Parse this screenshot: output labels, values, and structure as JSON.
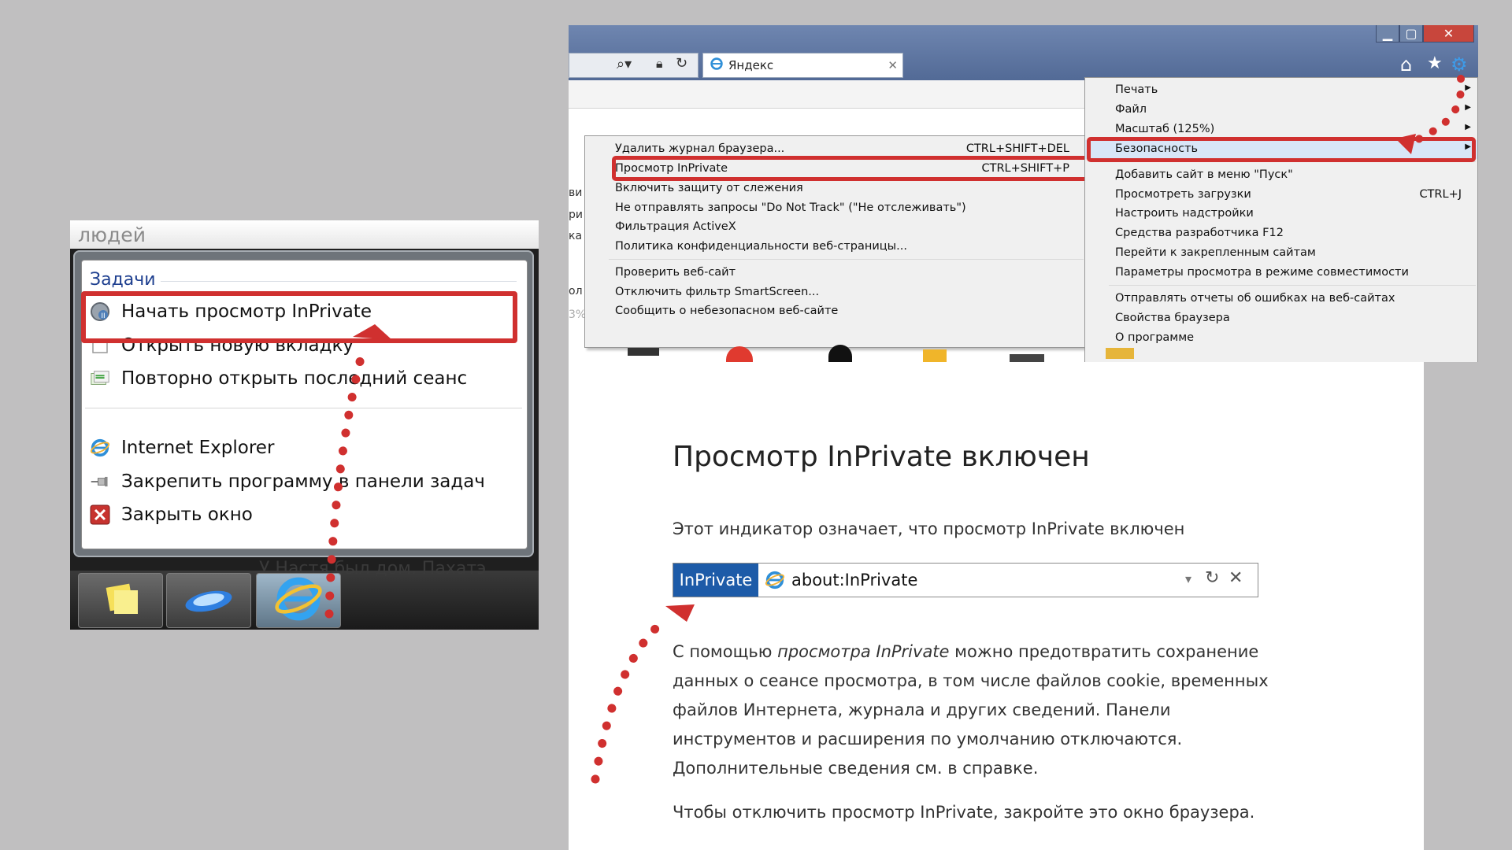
{
  "jumplist": {
    "top_text": "людей",
    "heading": "Задачи",
    "items": [
      {
        "label": "Начать просмотр InPrivate",
        "icon": "inprivate-icon"
      },
      {
        "label": "Открыть новую вкладку",
        "icon": "new-tab-icon"
      },
      {
        "label": "Повторно открыть последний сеанс",
        "icon": "reopen-session-icon"
      },
      {
        "label": "Internet Explorer",
        "icon": "ie-icon"
      },
      {
        "label": "Закрепить программу в панели задач",
        "icon": "pin-icon"
      },
      {
        "label": "Закрыть окно",
        "icon": "close-window-icon"
      }
    ],
    "background_text": "У Настя был дом. Пахатэ"
  },
  "browser": {
    "tab_title": "Яндекс",
    "tools_menu": {
      "items": [
        {
          "label": "Печать",
          "shortcut": "",
          "submenu": true
        },
        {
          "label": "Файл",
          "shortcut": "",
          "submenu": true
        },
        {
          "label": "Масштаб (125%)",
          "shortcut": "",
          "submenu": true
        },
        {
          "label": "Безопасность",
          "shortcut": "",
          "submenu": true
        },
        {
          "label": "Добавить сайт в меню \"Пуск\"",
          "shortcut": ""
        },
        {
          "label": "Просмотреть загрузки",
          "shortcut": "CTRL+J"
        },
        {
          "label": "Настроить надстройки",
          "shortcut": ""
        },
        {
          "label": "Средства разработчика F12",
          "shortcut": ""
        },
        {
          "label": "Перейти к закрепленным сайтам",
          "shortcut": ""
        },
        {
          "label": "Параметры просмотра в режиме совместимости",
          "shortcut": ""
        },
        {
          "label": "Отправлять отчеты об ошибках на веб-сайтах",
          "shortcut": ""
        },
        {
          "label": "Свойства браузера",
          "shortcut": ""
        },
        {
          "label": "О программе",
          "shortcut": ""
        }
      ]
    },
    "safety_menu": {
      "items": [
        {
          "label": "Удалить журнал браузера...",
          "shortcut": "CTRL+SHIFT+DEL"
        },
        {
          "label": "Просмотр InPrivate",
          "shortcut": "CTRL+SHIFT+P"
        },
        {
          "label": "Включить защиту от слежения",
          "shortcut": ""
        },
        {
          "label": "Не отправлять запросы \"Do Not Track\" (\"Не отслеживать\")",
          "shortcut": ""
        },
        {
          "label": "Фильтрация ActiveX",
          "shortcut": ""
        },
        {
          "label": "Политика конфиденциальности веб-страницы...",
          "shortcut": ""
        },
        {
          "label": "Проверить веб-сайт",
          "shortcut": ""
        },
        {
          "label": "Отключить фильтр SmartScreen...",
          "shortcut": ""
        },
        {
          "label": "Сообщить о небезопасном веб-сайте",
          "shortcut": ""
        }
      ]
    },
    "side_fragments": [
      "ви",
      "ри",
      "ка",
      "ол",
      "3%"
    ]
  },
  "inprivate_page": {
    "title": "Просмотр InPrivate включен",
    "indicator_text": "Этот индикатор означает, что просмотр InPrivate включен",
    "badge": "InPrivate",
    "url": "about:InPrivate",
    "body_prefix": "С помощью ",
    "body_em": "просмотра InPrivate",
    "body_suffix": " можно предотвратить сохранение данных о сеансе просмотра, в том числе файлов cookie, временных файлов Интернета, журнала и других сведений. Панели инструментов и расширения по умолчанию отключаются. Дополнительные сведения см. в справке.",
    "close_text": "Чтобы отключить просмотр InPrivate, закройте это окно браузера."
  },
  "colors": {
    "highlight_red": "#d0302f",
    "inprivate_blue": "#1d5ba8",
    "background_gray": "#c0bfc0"
  }
}
